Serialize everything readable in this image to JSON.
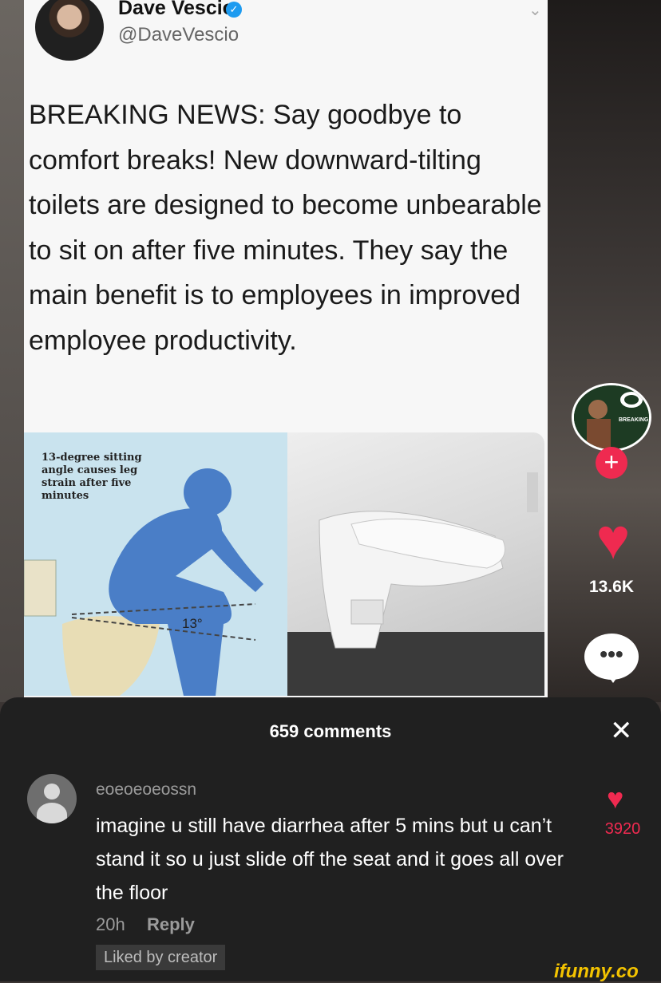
{
  "tweet": {
    "display_name": "Dave Vescio",
    "handle": "@DaveVescio",
    "text": "BREAKING NEWS: Say goodbye to comfort breaks! New downward-tilting toilets are designed to become unbearable to sit on after five minutes. They say the main benefit is to employees in improved employee productivity.",
    "diagram_caption": "13-degree sitting angle causes leg strain after five minutes",
    "angle_label": "13°"
  },
  "rail": {
    "creator_badge": "BREAKING",
    "likes": "13.6K"
  },
  "comments": {
    "title": "659 comments",
    "items": [
      {
        "username": "eoeoeoeossn",
        "text": "imagine u still have diarrhea after 5 mins but u can’t stand it so u just slide off the seat and it goes all over the floor",
        "time": "20h",
        "reply_label": "Reply",
        "liked_label": "Liked by creator",
        "likes": "3920"
      }
    ]
  },
  "watermark": "ifunny.co",
  "colors": {
    "accent": "#ef2a50",
    "sheet_bg": "#202020",
    "verified": "#1d9bf0"
  },
  "icons": [
    "verified-icon",
    "chevron-down-icon",
    "follow-plus-icon",
    "heart-icon",
    "comment-bubble-icon",
    "close-icon",
    "default-avatar-icon"
  ]
}
